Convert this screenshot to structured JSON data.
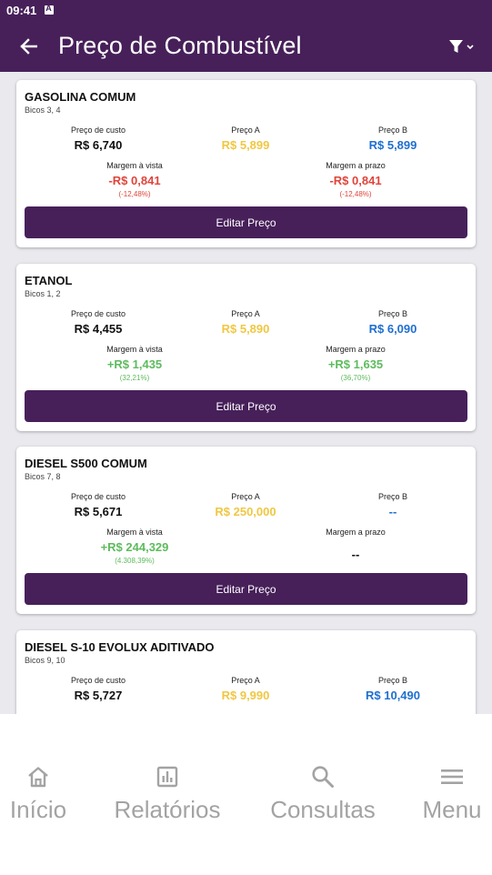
{
  "status": {
    "time": "09:41"
  },
  "appbar": {
    "title": "Preço de Combustível"
  },
  "labels": {
    "custo": "Preço de custo",
    "precoA": "Preço A",
    "precoB": "Preço B",
    "margemVista": "Margem à vista",
    "margemPrazo": "Margem a prazo",
    "editar": "Editar Preço"
  },
  "cards": [
    {
      "name": "GASOLINA COMUM",
      "bicos": "Bicos 3, 4",
      "custo": "R$ 6,740",
      "precoA": "R$ 5,899",
      "precoB": "R$ 5,899",
      "margemVista": "-R$ 0,841",
      "margemVistaPct": "(-12,48%)",
      "margemPrazo": "-R$ 0,841",
      "margemPrazoPct": "(-12,48%)"
    },
    {
      "name": "ETANOL",
      "bicos": "Bicos 1, 2",
      "custo": "R$ 4,455",
      "precoA": "R$ 5,890",
      "precoB": "R$ 6,090",
      "margemVista": "+R$ 1,435",
      "margemVistaPct": "(32,21%)",
      "margemPrazo": "+R$ 1,635",
      "margemPrazoPct": "(36,70%)"
    },
    {
      "name": "DIESEL S500 COMUM",
      "bicos": "Bicos 7, 8",
      "custo": "R$ 5,671",
      "precoA": "R$ 250,000",
      "precoB": "--",
      "margemVista": "+R$ 244,329",
      "margemVistaPct": "(4.308,39%)",
      "margemPrazo": "--",
      "margemPrazoPct": ""
    },
    {
      "name": "DIESEL S-10 EVOLUX ADITIVADO",
      "bicos": "Bicos 9, 10",
      "custo": "R$ 5,727",
      "precoA": "R$ 9,990",
      "precoB": "R$ 10,490"
    }
  ],
  "nav": {
    "inicio": "Início",
    "relatorios": "Relatórios",
    "consultas": "Consultas",
    "menu": "Menu"
  },
  "colors": {
    "primary": "#47205a",
    "gold": "#f0c742",
    "blue": "#1f6fd0",
    "red": "#e0443a",
    "green": "#5dbb5d"
  }
}
